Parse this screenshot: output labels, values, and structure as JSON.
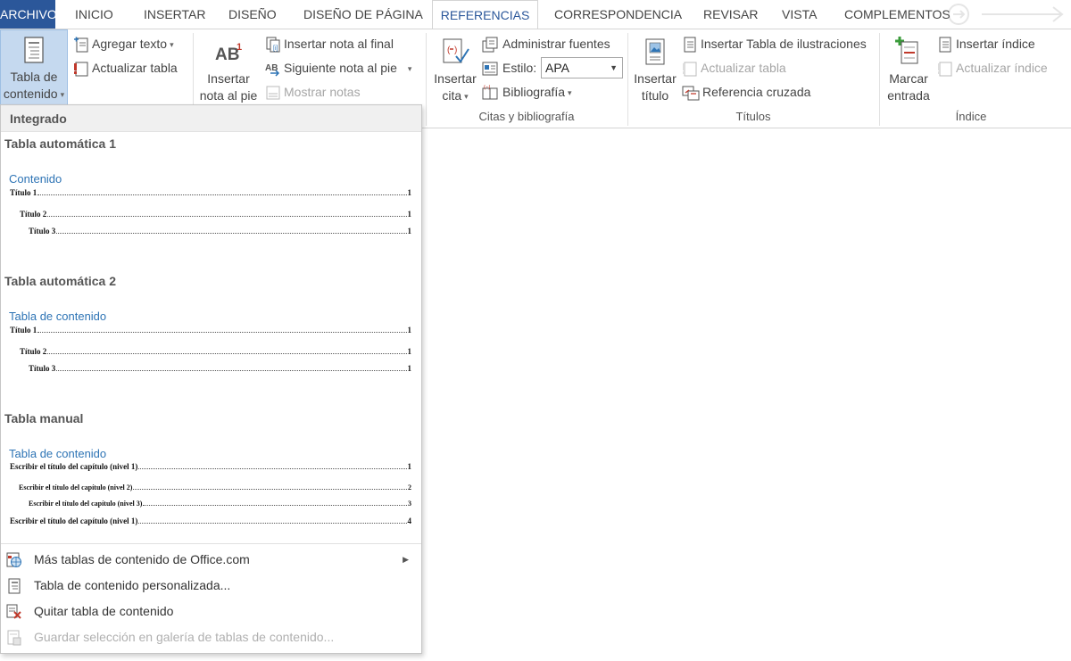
{
  "tabs": {
    "file": "ARCHIVO",
    "items": [
      "INICIO",
      "INSERTAR",
      "DISEÑO",
      "DISEÑO DE PÁGINA",
      "REFERENCIAS",
      "CORRESPONDENCIA",
      "REVISAR",
      "VISTA",
      "COMPLEMENTOS"
    ],
    "active": "REFERENCIAS"
  },
  "ribbon": {
    "toc": {
      "line1": "Tabla de",
      "line2": "contenido",
      "add_text": "Agregar texto",
      "update_table": "Actualizar tabla"
    },
    "footnotes": {
      "insert_line1": "Insertar",
      "insert_line2": "nota al pie",
      "endnote": "Insertar nota al final",
      "next_footnote": "Siguiente nota al pie",
      "show_notes": "Mostrar notas"
    },
    "citations": {
      "insert_line1": "Insertar",
      "insert_line2": "cita",
      "manage_sources": "Administrar fuentes",
      "style_label": "Estilo:",
      "style_value": "APA",
      "bibliography": "Bibliografía",
      "group_label": "Citas y bibliografía"
    },
    "captions": {
      "insert_line1": "Insertar",
      "insert_line2": "título",
      "insert_table_figures": "Insertar Tabla de ilustraciones",
      "update_table": "Actualizar tabla",
      "cross_reference": "Referencia cruzada",
      "group_label": "Títulos"
    },
    "index": {
      "mark_line1": "Marcar",
      "mark_line2": "entrada",
      "insert_index": "Insertar índice",
      "update_index": "Actualizar índice",
      "group_label": "Índice"
    }
  },
  "dropdown": {
    "header": "Integrado",
    "auto1": {
      "title": "Tabla automática 1",
      "heading": "Contenido",
      "lines": [
        {
          "text": "Título 1",
          "page": "1"
        },
        {
          "text": "Título 2",
          "page": "1"
        },
        {
          "text": "Título 3",
          "page": "1"
        }
      ]
    },
    "auto2": {
      "title": "Tabla automática 2",
      "heading": "Tabla de contenido",
      "lines": [
        {
          "text": "Título 1",
          "page": "1"
        },
        {
          "text": "Título 2",
          "page": "1"
        },
        {
          "text": "Título 3",
          "page": "1"
        }
      ]
    },
    "manual": {
      "title": "Tabla manual",
      "heading": "Tabla de contenido",
      "lines": [
        {
          "text": "Escribir el título del capítulo (nivel 1)",
          "page": "1"
        },
        {
          "text": "Escribir el título del capítulo (nivel 2)",
          "page": "2"
        },
        {
          "text": "Escribir el título del capítulo (nivel 3)",
          "page": "3"
        },
        {
          "text": "Escribir el título del capítulo (nivel 1)",
          "page": "4"
        }
      ]
    },
    "menu": {
      "more_tables": "Más tablas de contenido de Office.com",
      "custom_table": "Tabla de contenido personalizada...",
      "remove_table": "Quitar tabla de contenido",
      "save_selection": "Guardar selección en galería de tablas de contenido..."
    }
  },
  "colors": {
    "accent": "#2b579a",
    "heading_blue": "#2e74b5",
    "selected_button": "#c5d9ef"
  }
}
